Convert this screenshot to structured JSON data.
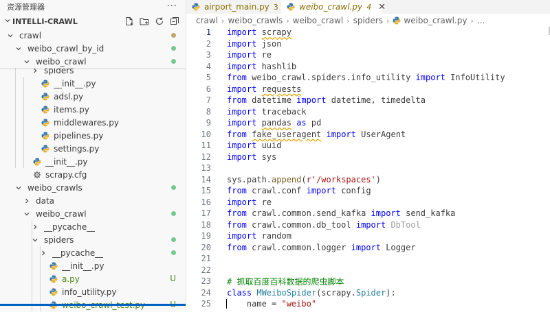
{
  "explorer": {
    "title": "资源管理器",
    "more_label": "···",
    "section": "INTELLI-CRAWL",
    "tree": [
      {
        "label": "crawl",
        "kind": "folder",
        "open": true,
        "depth": 0,
        "dot": "#c2a76b"
      },
      {
        "label": "weibo_crawl_by_id",
        "kind": "folder",
        "open": true,
        "depth": 1,
        "dot": "#73c991"
      },
      {
        "label": "weibo_crawl",
        "kind": "folder",
        "open": true,
        "depth": 2,
        "dot": "#73c991"
      },
      {
        "label": "spiders",
        "kind": "folder",
        "open": false,
        "depth": 3
      },
      {
        "label": "__init__.py",
        "kind": "py",
        "depth": 3
      },
      {
        "label": "adsl.py",
        "kind": "py",
        "depth": 3
      },
      {
        "label": "items.py",
        "kind": "py",
        "depth": 3
      },
      {
        "label": "middlewares.py",
        "kind": "py",
        "depth": 3
      },
      {
        "label": "pipelines.py",
        "kind": "py",
        "depth": 3
      },
      {
        "label": "settings.py",
        "kind": "py",
        "depth": 3
      },
      {
        "label": "__init__.py",
        "kind": "py",
        "depth": 2
      },
      {
        "label": "scrapy.cfg",
        "kind": "cfg",
        "depth": 2
      },
      {
        "label": "weibo_crawls",
        "kind": "folder",
        "open": true,
        "depth": 1,
        "dot": "#73c991"
      },
      {
        "label": "data",
        "kind": "folder",
        "open": false,
        "depth": 2
      },
      {
        "label": "weibo_crawl",
        "kind": "folder",
        "open": true,
        "depth": 2,
        "dot": "#73c991"
      },
      {
        "label": "__pycache__",
        "kind": "folder",
        "open": false,
        "depth": 3
      },
      {
        "label": "spiders",
        "kind": "folder",
        "open": true,
        "depth": 3,
        "dot": "#73c991"
      },
      {
        "label": "__pycache__",
        "kind": "folder",
        "open": false,
        "depth": 4,
        "dot": "#73c991"
      },
      {
        "label": "__init__.py",
        "kind": "py",
        "depth": 4
      },
      {
        "label": "a.py",
        "kind": "py",
        "depth": 4,
        "status": "U",
        "status_color": "#4e8a1e",
        "label_color": "#4e8a1e"
      },
      {
        "label": "info_utility.py",
        "kind": "py",
        "depth": 4
      },
      {
        "label": "weibo_crawl_test.py",
        "kind": "py",
        "depth": 4,
        "status": "U",
        "status_color": "#4e8a1e",
        "label_color": "#4e8a1e"
      }
    ]
  },
  "tabs": [
    {
      "label": "airport_main.py",
      "badge": "3",
      "badge_color": "#8a6d00",
      "label_color": "#8a6d00",
      "active": false
    },
    {
      "label": "weibo_crawl.py",
      "badge": "4",
      "badge_color": "#8a6d00",
      "label_color": "#8a6d00",
      "active": true,
      "close": "✕"
    }
  ],
  "breadcrumb": [
    "crawl",
    "weibo_crawls",
    "weibo_crawl",
    "spiders",
    "weibo_crawl.py",
    "..."
  ],
  "current_line": 1,
  "code": [
    [
      [
        "kw",
        "import"
      ],
      [
        "t",
        " "
      ],
      [
        "sq",
        "scrapy"
      ]
    ],
    [
      [
        "kw",
        "import"
      ],
      [
        "t",
        " json"
      ]
    ],
    [
      [
        "kw",
        "import"
      ],
      [
        "t",
        " re"
      ]
    ],
    [
      [
        "kw",
        "import"
      ],
      [
        "t",
        " hashlib"
      ]
    ],
    [
      [
        "kw",
        "from"
      ],
      [
        "t",
        " weibo_crawl.spiders.info_utility "
      ],
      [
        "kw",
        "import"
      ],
      [
        "t",
        " InfoUtility"
      ]
    ],
    [
      [
        "kw",
        "import"
      ],
      [
        "t",
        " "
      ],
      [
        "sq",
        "requests"
      ]
    ],
    [
      [
        "kw",
        "from"
      ],
      [
        "t",
        " datetime "
      ],
      [
        "kw",
        "import"
      ],
      [
        "t",
        " datetime, timedelta"
      ]
    ],
    [
      [
        "kw",
        "import"
      ],
      [
        "t",
        " traceback"
      ]
    ],
    [
      [
        "kw",
        "import"
      ],
      [
        "t",
        " "
      ],
      [
        "sq",
        "pandas"
      ],
      [
        "t",
        " "
      ],
      [
        "kw",
        "as"
      ],
      [
        "t",
        " pd"
      ]
    ],
    [
      [
        "kw",
        "from"
      ],
      [
        "t",
        " "
      ],
      [
        "sq",
        "fake_useragent"
      ],
      [
        "t",
        " "
      ],
      [
        "kw",
        "import"
      ],
      [
        "t",
        " UserAgent"
      ]
    ],
    [
      [
        "kw",
        "import"
      ],
      [
        "t",
        " uuid"
      ]
    ],
    [
      [
        "kw",
        "import"
      ],
      [
        "t",
        " sys"
      ]
    ],
    [],
    [
      [
        "t",
        "sys.path."
      ],
      [
        "fn",
        "append"
      ],
      [
        "t",
        "("
      ],
      [
        "str",
        "r'/workspaces'"
      ],
      [
        "t",
        ")"
      ]
    ],
    [
      [
        "kw",
        "from"
      ],
      [
        "t",
        " crawl.conf "
      ],
      [
        "kw",
        "import"
      ],
      [
        "t",
        " config"
      ]
    ],
    [
      [
        "kw",
        "import"
      ],
      [
        "t",
        " re"
      ]
    ],
    [
      [
        "kw",
        "from"
      ],
      [
        "t",
        " crawl.common.send_kafka "
      ],
      [
        "kw",
        "import"
      ],
      [
        "t",
        " send_kafka"
      ]
    ],
    [
      [
        "kw",
        "from"
      ],
      [
        "t",
        " crawl.common.db_tool "
      ],
      [
        "kw",
        "import"
      ],
      [
        "t",
        " "
      ],
      [
        "dim",
        "DbTool"
      ]
    ],
    [
      [
        "kw",
        "import"
      ],
      [
        "t",
        " random"
      ]
    ],
    [
      [
        "kw",
        "from"
      ],
      [
        "t",
        " crawl.common.logger "
      ],
      [
        "kw",
        "import"
      ],
      [
        "t",
        " Logger"
      ]
    ],
    [],
    [],
    [
      [
        "cmt",
        "# 抓取百度百科数据的爬虫脚本"
      ]
    ],
    [
      [
        "kw",
        "class"
      ],
      [
        "t",
        " "
      ],
      [
        "cls",
        "MWeiboSpider"
      ],
      [
        "t",
        "(scrapy."
      ],
      [
        "cls",
        "Spider"
      ],
      [
        "t",
        "):"
      ]
    ],
    [
      [
        "t",
        "    name = "
      ],
      [
        "str",
        "\"weibo\""
      ]
    ]
  ]
}
